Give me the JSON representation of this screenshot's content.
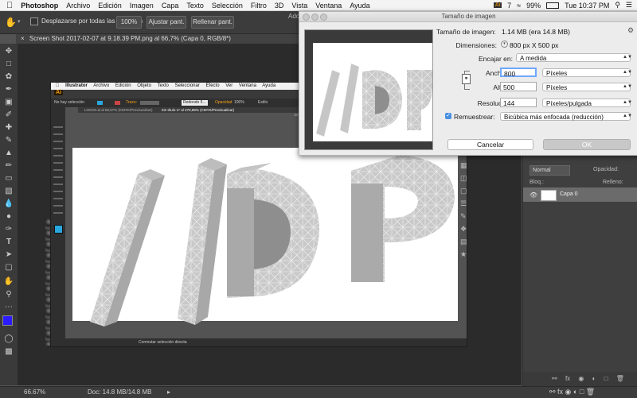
{
  "menubar": {
    "app": "Photoshop",
    "items": [
      "Archivo",
      "Edición",
      "Imagen",
      "Capa",
      "Texto",
      "Selección",
      "Filtro",
      "3D",
      "Vista",
      "Ventana",
      "Ayuda"
    ],
    "battery": "99%",
    "clock": "Tue 10:37 PM",
    "ai_count": "7"
  },
  "optbar": {
    "scroll_all": "Desplazarse por todas las ventanas",
    "zoom_100": "100%",
    "fit_screen": "Ajustar pant.",
    "fill_screen": "Rellenar pant."
  },
  "document": {
    "tab_title": "Screen Shot 2017-02-07 at 9.18.39 PM.png al 66,7% (Capa 0, RGB/8*)",
    "window_title_partial": "Ado"
  },
  "illustrator": {
    "app": "Illustrator",
    "menu": [
      "Archivo",
      "Edición",
      "Objeto",
      "Texto",
      "Seleccionar",
      "Efecto",
      "Ver",
      "Ventana",
      "Ayuda"
    ],
    "logo": "Ai",
    "no_selection": "No hay selección",
    "trazo": "Trazo:",
    "basic": "Redondo 5...",
    "opacity": "Opacidad",
    "opacity_val": "100%",
    "style": "Estilo",
    "tab1": "LOGOs.ai al 66,67% (CMYK/Previsualizar)",
    "tab2": "Sin título-1* al 376,89% (CMYK/Previsualizar)",
    "doc_title": "Sin título-1* al 376,89% (CMYK/Previsualizar)",
    "status": "Conmutar selección directa",
    "artwork_text": "//DP"
  },
  "dialog": {
    "title": "Tamaño de imagen",
    "size_label": "Tamaño de imagen:",
    "size_value": "1.14 MB (era 14.8 MB)",
    "dims_label": "Dimensiones:",
    "dims_value": "800 px X 500 px",
    "fit_label": "Encajar en:",
    "fit_value": "A medida",
    "width_label": "Anchura:",
    "width_value": "800",
    "width_unit": "Píxeles",
    "height_label": "Altura:",
    "height_value": "500",
    "height_unit": "Píxeles",
    "res_label": "Resolución:",
    "res_value": "144",
    "res_unit": "Píxeles/pulgada",
    "resample_label": "Remuestrear:",
    "resample_value": "Bicúbica más enfocada (reducción)",
    "cancel": "Cancelar",
    "ok": "OK"
  },
  "layers": {
    "blend": "Normal",
    "opacity_label": "Opacidad:",
    "lock_label": "Bloq.:",
    "fill_label": "Relleno:",
    "layer_name": "Capa 0"
  },
  "status": {
    "zoom": "66.67%",
    "doc": "Doc: 14.8 MB/14.8 MB"
  },
  "colors": {
    "ps_bg": "#535353",
    "dialog_bg": "#ececec",
    "ok_button": "#c8c8c8",
    "fg_swatch": "#2d1bff",
    "ai_swatch": "#29a8e0"
  }
}
